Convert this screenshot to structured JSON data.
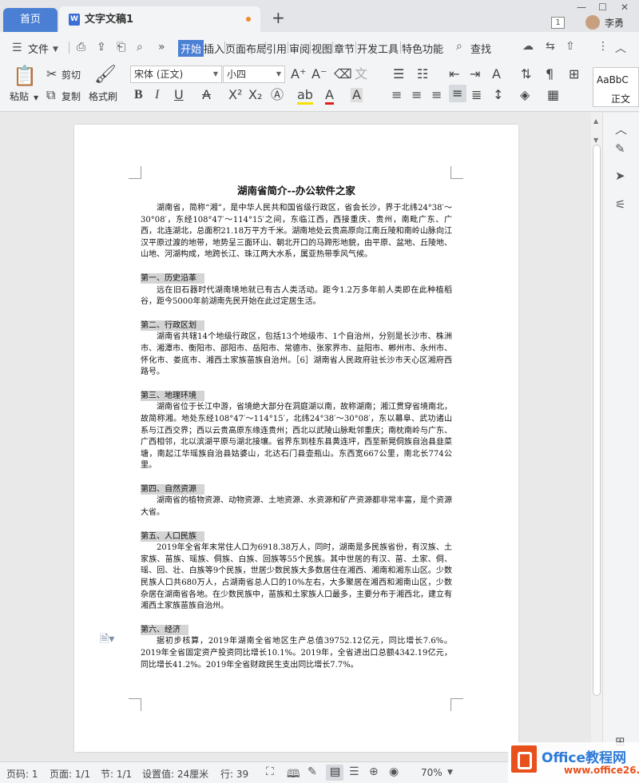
{
  "titlebar": {
    "home_tab": "首页",
    "doc_tab": "文字文稿1",
    "doc_icon": "W",
    "add_tab": "+",
    "window_count": "1",
    "username": "李勇"
  },
  "menubar": {
    "file": "文件",
    "tabs": [
      "开始",
      "插入",
      "页面布局",
      "引用",
      "审阅",
      "视图",
      "章节",
      "开发工具",
      "特色功能"
    ],
    "search": "查找"
  },
  "toolbar": {
    "paste": "粘贴",
    "cut": "剪切",
    "copy": "复制",
    "format_painter": "格式刷",
    "font_name": "宋体 (正文)",
    "font_size": "小四",
    "styles": [
      "AaBbC",
      "正文"
    ]
  },
  "document": {
    "title": "湖南省简介--办公软件之家",
    "intro": "湖南省，简称“湘”，是中华人民共和国省级行政区，省会长沙，界于北纬24°38′～30°08′，东经108°47′～114°15′之间，东临江西，西接重庆、贵州，南毗广东、广西，北连湖北，总面积21.18万平方千米。湖南地处云贵高原向江南丘陵和南岭山脉向江汉平原过渡的地带，地势呈三面环山、朝北开口的马蹄形地貌，由平原、盆地、丘陵地、山地、河湖构成，地跨长江、珠江两大水系，属亚热带季风气候。",
    "sections": [
      {
        "heading": "第一、历史沿革",
        "body": "远在旧石器时代湖南境地就已有古人类活动。距今1.2万多年前人类即在此种植稻谷，距今5000年前湖南先民开始在此过定居生活。"
      },
      {
        "heading": "第二、行政区划",
        "body": "湖南省共辖14个地级行政区，包括13个地级市、1个自治州，分别是长沙市、株洲市、湘潭市、衡阳市、邵阳市、岳阳市、常德市、张家界市、益阳市、郴州市、永州市、怀化市、娄底市、湘西土家族苗族自治州。［6］湖南省人民政府驻长沙市天心区湘府西路号。"
      },
      {
        "heading": "第三、地理环境",
        "body": "湖南省位于长江中游，省境绝大部分在洞庭湖以南，故称湖南；湘江贯穿省境南北，故简称湘。地处东经108°47′～114°15′，北纬24°38′～30°08′，东以幕阜、武功诸山系与江西交界；西以云贵高原东缘连贵州；西北以武陵山脉毗邻重庆；南枕南岭与广东、广西相邻，北以滨湖平原与湖北接壤。省界东到桂东县黄连坪，西至新晃侗族自治县韭菜塘，南起江华瑶族自治县姑婆山，北达石门县壶瓶山。东西宽667公里，南北长774公里。"
      },
      {
        "heading": "第四、自然资源",
        "body": "湖南省的植物资源、动物资源、土地资源、水资源和矿产资源都非常丰富，是个资源大省。"
      },
      {
        "heading": "第五、人口民族",
        "body": "2019年全省年末常住人口为6918.38万人，同时，湖南是多民族省份，有汉族、土家族、苗族、瑶族、侗族、白族、回族等55个民族。其中世居的有汉、苗、土家、侗、瑶、回、壮、白族等9个民族，世居少数民族大多数居住在湘西、湘南和湘东山区。少数民族人口共680万人，占湖南省总人口的10%左右，大多聚居在湘西和湘南山区，少数杂居在湖南省各地。在少数民族中，苗族和土家族人口最多，主要分布于湘西北，建立有湘西土家族苗族自治州。"
      },
      {
        "heading": "第六、经济",
        "body": "据初步核算，2019年湖南全省地区生产总值39752.12亿元，同比增长7.6%。2019年全省固定资产投资同比增长10.1%。2019年，全省进出口总额4342.19亿元，同比增长41.2%。2019年全省财政民生支出同比增长7.7%。"
      }
    ]
  },
  "statusbar": {
    "page_num": "页码: 1",
    "pages": "页面: 1/1",
    "section": "节: 1/1",
    "setting": "设置值: 24厘米",
    "row": "行: 39",
    "zoom": "70%"
  },
  "watermark": {
    "line1": "Office教程网",
    "line2": "www.office26.com"
  }
}
